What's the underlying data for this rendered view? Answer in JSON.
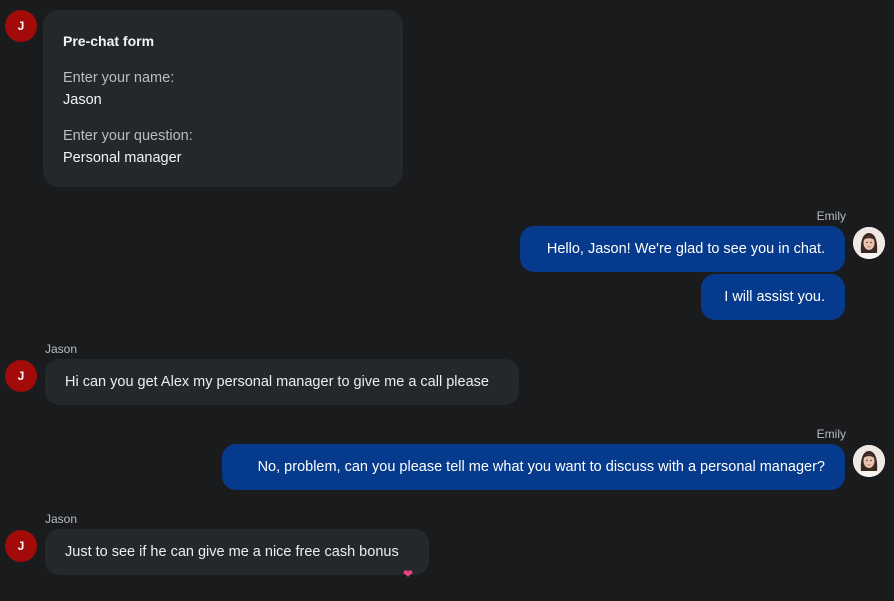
{
  "prechat": {
    "title": "Pre-chat form",
    "name_label": "Enter your name:",
    "name_value": "Jason",
    "question_label": "Enter your question:",
    "question_value": "Personal manager"
  },
  "user": {
    "name": "Jason",
    "initial": "J"
  },
  "agent": {
    "name": "Emily"
  },
  "messages": [
    {
      "text": "Hello, Jason! We're glad to see you in chat."
    },
    {
      "text": "I will assist you."
    },
    {
      "text": "Hi can you get Alex my personal manager to give me a call please"
    },
    {
      "text": "No, problem, can you please tell me what you want to discuss with a personal manager?"
    },
    {
      "text": "Just to see if he can give me a nice free cash bonus"
    }
  ],
  "reaction": {
    "glyph": "❤",
    "icon": "heart-icon",
    "color": "#f0437a"
  },
  "colors": {
    "background": "#1a1b1d",
    "incoming_bubble": "#24272b",
    "outgoing_bubble": "#063a8c",
    "user_avatar": "#a30b0b"
  }
}
